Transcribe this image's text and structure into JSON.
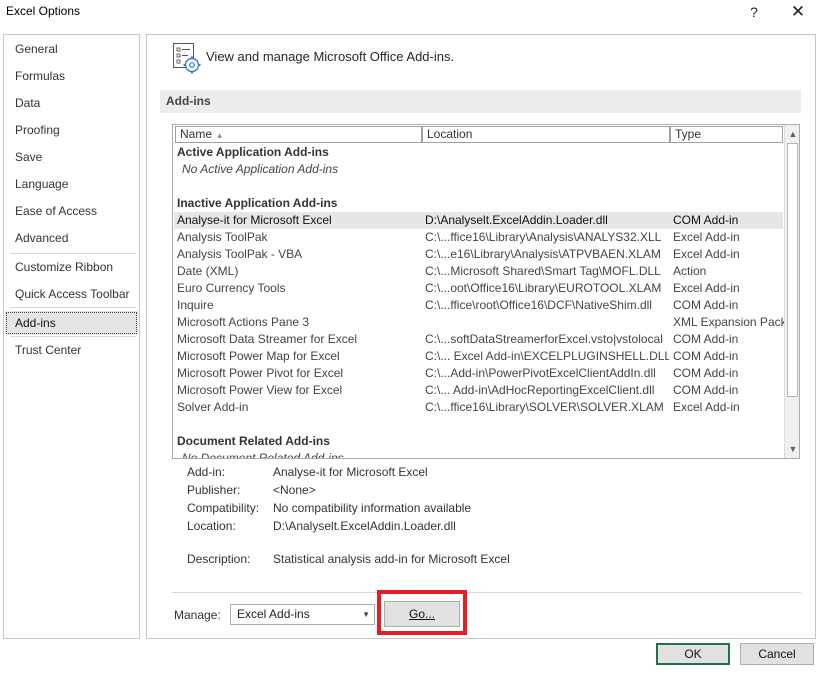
{
  "window": {
    "title": "Excel Options",
    "help_glyph": "?",
    "close_glyph": "✕"
  },
  "sidebar": {
    "items": [
      {
        "label": "General"
      },
      {
        "label": "Formulas"
      },
      {
        "label": "Data"
      },
      {
        "label": "Proofing"
      },
      {
        "label": "Save"
      },
      {
        "label": "Language"
      },
      {
        "label": "Ease of Access"
      },
      {
        "label": "Advanced"
      },
      {
        "label": "Customize Ribbon"
      },
      {
        "label": "Quick Access Toolbar"
      },
      {
        "label": "Add-ins",
        "selected": true
      },
      {
        "label": "Trust Center"
      }
    ]
  },
  "header": {
    "text": "View and manage Microsoft Office Add-ins.",
    "icon": "addins-gear-icon"
  },
  "section": {
    "title": "Add-ins"
  },
  "table": {
    "columns": {
      "name": "Name",
      "sort_glyph": "▴",
      "location": "Location",
      "type": "Type"
    },
    "active_group": "Active Application Add-ins",
    "active_empty": "No Active Application Add-ins",
    "inactive_group": "Inactive Application Add-ins",
    "rows": [
      {
        "name": "Analyse-it for Microsoft Excel",
        "location": "D:\\Analyselt.ExcelAddin.Loader.dll",
        "type": "COM Add-in"
      },
      {
        "name": "Analysis ToolPak",
        "location": "C:\\...ffice16\\Library\\Analysis\\ANALYS32.XLL",
        "type": "Excel Add-in"
      },
      {
        "name": "Analysis ToolPak - VBA",
        "location": "C:\\...e16\\Library\\Analysis\\ATPVBAEN.XLAM",
        "type": "Excel Add-in"
      },
      {
        "name": "Date (XML)",
        "location": "C:\\...Microsoft Shared\\Smart Tag\\MOFL.DLL",
        "type": "Action"
      },
      {
        "name": "Euro Currency Tools",
        "location": "C:\\...oot\\Office16\\Library\\EUROTOOL.XLAM",
        "type": "Excel Add-in"
      },
      {
        "name": "Inquire",
        "location": "C:\\...ffice\\root\\Office16\\DCF\\NativeShim.dll",
        "type": "COM Add-in"
      },
      {
        "name": "Microsoft Actions Pane 3",
        "location": "",
        "type": "XML Expansion Pack"
      },
      {
        "name": "Microsoft Data Streamer for Excel",
        "location": "C:\\...softDataStreamerforExcel.vsto|vstolocal",
        "type": "COM Add-in"
      },
      {
        "name": "Microsoft Power Map for Excel",
        "location": "C:\\... Excel Add-in\\EXCELPLUGINSHELL.DLL",
        "type": "COM Add-in"
      },
      {
        "name": "Microsoft Power Pivot for Excel",
        "location": "C:\\...Add-in\\PowerPivotExcelClientAddIn.dll",
        "type": "COM Add-in"
      },
      {
        "name": "Microsoft Power View for Excel",
        "location": "C:\\... Add-in\\AdHocReportingExcelClient.dll",
        "type": "COM Add-in"
      },
      {
        "name": "Solver Add-in",
        "location": "C:\\...ffice16\\Library\\SOLVER\\SOLVER.XLAM",
        "type": "Excel Add-in"
      }
    ],
    "document_group": "Document Related Add-ins",
    "document_empty": "No Document Related Add-ins",
    "scroll_up_glyph": "▲",
    "scroll_down_glyph": "▼"
  },
  "details": {
    "addin_label": "Add-in:",
    "addin_value": "Analyse-it for Microsoft Excel",
    "publisher_label": "Publisher:",
    "publisher_value": "<None>",
    "compatibility_label": "Compatibility:",
    "compatibility_value": "No compatibility information available",
    "location_label": "Location:",
    "location_value": "D:\\Analyselt.ExcelAddin.Loader.dll",
    "description_label": "Description:",
    "description_value": "Statistical analysis add-in for Microsoft Excel"
  },
  "manage": {
    "label": "Manage:",
    "selected": "Excel Add-ins",
    "arrow_glyph": "▼",
    "go_label": "Go..."
  },
  "footer": {
    "ok_label": "OK",
    "cancel_label": "Cancel"
  },
  "colors": {
    "highlight": "#e41e25",
    "ok_border": "#1f7246"
  }
}
